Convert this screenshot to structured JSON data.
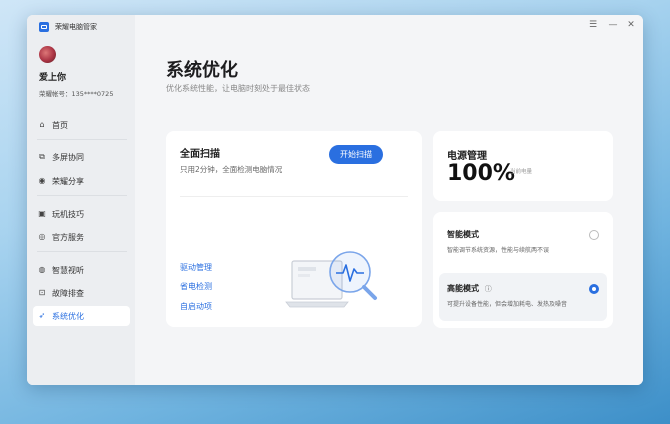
{
  "app": {
    "title": "荣耀电脑管家"
  },
  "window_controls": {
    "menu": "☰",
    "minimize": "—",
    "close": "✕"
  },
  "user": {
    "name": "爱上你",
    "account": "荣耀帐号：135****0725"
  },
  "nav": [
    {
      "label": "首页",
      "icon": "home-icon"
    },
    {
      "label": "多屏协同",
      "icon": "multiscreen-icon"
    },
    {
      "label": "荣耀分享",
      "icon": "share-icon"
    },
    {
      "label": "玩机技巧",
      "icon": "tips-icon"
    },
    {
      "label": "官方服务",
      "icon": "service-icon"
    },
    {
      "label": "智慧视听",
      "icon": "audio-visual-icon"
    },
    {
      "label": "故障排查",
      "icon": "troubleshoot-icon"
    },
    {
      "label": "系统优化",
      "icon": "rocket-icon",
      "active": true
    }
  ],
  "page": {
    "title": "系统优化",
    "subtitle": "优化系统性能，让电脑时刻处于最佳状态"
  },
  "scan_card": {
    "title": "全面扫描",
    "subtitle": "只用2分钟，全面检测电脑情况",
    "button": "开始扫描",
    "links": [
      "驱动管理",
      "省电检测",
      "自启动项"
    ]
  },
  "power_card": {
    "title": "电源管理",
    "value": "100%",
    "caption": "当前电量"
  },
  "modes": [
    {
      "title": "智能模式",
      "desc": "智能调节系统资源，性能与续航两不误",
      "selected": false
    },
    {
      "title": "高能模式",
      "desc": "可提升设备性能，但会增加耗电、发热及噪音",
      "selected": true,
      "info_icon": "ⓘ"
    }
  ],
  "colors": {
    "accent": "#2a6fe0"
  }
}
